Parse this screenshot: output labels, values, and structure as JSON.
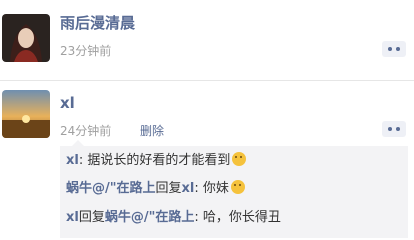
{
  "posts": [
    {
      "username": "雨后漫清晨",
      "time": "23分钟前"
    },
    {
      "username": "xl",
      "time": "24分钟前",
      "delete_label": "删除",
      "comments": [
        {
          "author": "xl",
          "separator": ": ",
          "text": "据说长的好看的才能看到",
          "emoji": "smile-emoji"
        },
        {
          "author": "蜗牛@/\"在路上",
          "reply_word": "回复",
          "target": "xl",
          "separator": ": ",
          "text": "你妹",
          "emoji": "smile-emoji"
        },
        {
          "author": "xl",
          "reply_word": "回复",
          "target": "蜗牛@/\"在路上",
          "separator": ": ",
          "text": "哈，你长得丑"
        }
      ]
    }
  ],
  "colors": {
    "link": "#586b94",
    "time": "#a0a0a0",
    "comment_bg": "#f3f3f5"
  }
}
